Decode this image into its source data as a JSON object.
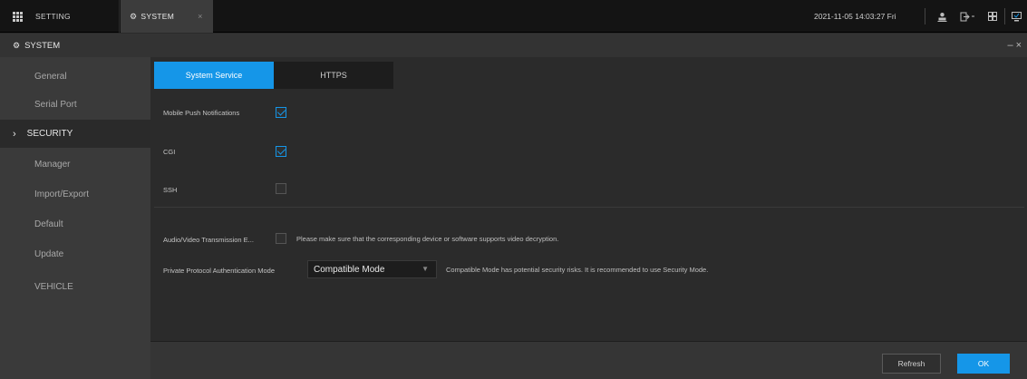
{
  "topbar": {
    "setting_tab": "SETTING",
    "system_tab": "SYSTEM",
    "close_glyph": "×",
    "datetime": "2021-11-05 14:03:27 Fri",
    "icons": [
      "user-icon",
      "logout-icon",
      "grid-view-icon",
      "monitor-icon"
    ]
  },
  "titlebar": {
    "title": "SYSTEM",
    "minimize": "–",
    "close": "×"
  },
  "sidebar": {
    "items": [
      {
        "label": "General"
      },
      {
        "label": "Serial Port"
      },
      {
        "label": "SECURITY",
        "active": true
      },
      {
        "label": "Manager"
      },
      {
        "label": "Import/Export"
      },
      {
        "label": "Default"
      },
      {
        "label": "Update"
      },
      {
        "label": "VEHICLE"
      }
    ]
  },
  "main": {
    "tabs": [
      {
        "label": "System Service",
        "active": true
      },
      {
        "label": "HTTPS"
      }
    ],
    "rows": {
      "mobile_push": {
        "label": "Mobile Push Notifications",
        "checked": true
      },
      "cgi": {
        "label": "CGI",
        "checked": true
      },
      "ssh": {
        "label": "SSH",
        "checked": false
      },
      "av_transmission": {
        "label": "Audio/Video Transmission E...",
        "checked": false,
        "note": "Please make sure that the corresponding device or software supports video decryption."
      },
      "private_protocol": {
        "label": "Private Protocol Authentication Mode",
        "value": "Compatible Mode",
        "note": "Compatible Mode has potential security risks. It is recommended to use Security Mode."
      }
    }
  },
  "footer": {
    "refresh": "Refresh",
    "ok": "OK"
  },
  "colors": {
    "accent": "#1596e8",
    "background": "#2b2b2b",
    "sidebar": "#3a3a3a"
  }
}
